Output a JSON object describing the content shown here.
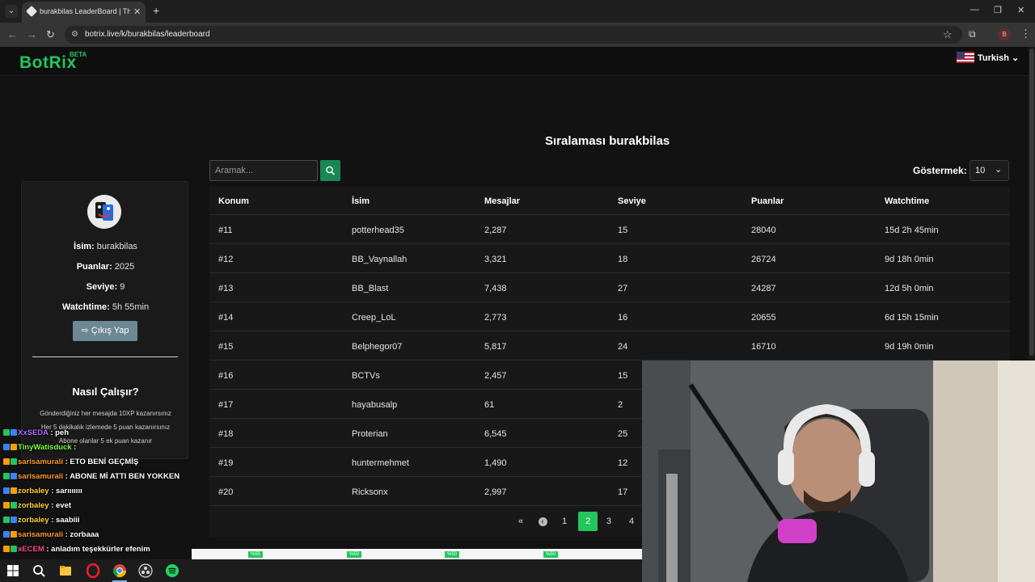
{
  "browser": {
    "tab_title": "burakbilas LeaderBoard | The b",
    "url": "botrix.live/k/burakbilas/leaderboard",
    "profile_initial": "B"
  },
  "header": {
    "logo": "BotRix",
    "beta": "BETA",
    "language": "Turkish"
  },
  "page": {
    "title": "Sıralaması burakbilas",
    "search_placeholder": "Aramak...",
    "show_label": "Göstermek:",
    "show_value": "10"
  },
  "profile": {
    "name_label": "İsim:",
    "name": "burakbilas",
    "points_label": "Puanlar:",
    "points": "2025",
    "level_label": "Seviye:",
    "level": "9",
    "watch_label": "Watchtime:",
    "watchtime": "5h 55min",
    "logout": "Çıkış Yap",
    "how_title": "Nasıl Çalışır?",
    "how_lines": [
      "Gönderdiğiniz her mesajda 10XP kazanırsınız",
      "Her 5 dakikalık izlemede 5 puan kazanırsınız",
      "Abone olanlar 5 ek puan kazanır"
    ]
  },
  "table": {
    "headers": [
      "Konum",
      "İsim",
      "Mesajlar",
      "Seviye",
      "Puanlar",
      "Watchtime"
    ],
    "rows": [
      [
        "#11",
        "potterhead35",
        "2,287",
        "15",
        "28040",
        "15d 2h 45min"
      ],
      [
        "#12",
        "BB_Vaynallah",
        "3,321",
        "18",
        "26724",
        "9d 18h 0min"
      ],
      [
        "#13",
        "BB_Blast",
        "7,438",
        "27",
        "24287",
        "12d 5h 0min"
      ],
      [
        "#14",
        "Creep_LoL",
        "2,773",
        "16",
        "20655",
        "6d 15h 15min"
      ],
      [
        "#15",
        "Belphegor07",
        "5,817",
        "24",
        "16710",
        "9d 19h 0min"
      ],
      [
        "#16",
        "BCTVs",
        "2,457",
        "15",
        "",
        ""
      ],
      [
        "#17",
        "hayabusalp",
        "61",
        "2",
        "",
        ""
      ],
      [
        "#18",
        "Proterian",
        "6,545",
        "25",
        "",
        ""
      ],
      [
        "#19",
        "huntermehmet",
        "1,490",
        "12",
        "",
        ""
      ],
      [
        "#20",
        "Ricksonx",
        "2,997",
        "17",
        "",
        ""
      ]
    ]
  },
  "pagination": {
    "first": "«",
    "prev": "‹",
    "pages": [
      "1",
      "2",
      "3",
      "4"
    ],
    "active": "2"
  },
  "strip": {
    "percents": [
      "%55",
      "%50",
      "%50",
      "%50"
    ]
  },
  "chat": [
    {
      "user": "XxSEDA",
      "msg": ": peh",
      "color": "#b06bff"
    },
    {
      "user": "TinyWatisduck",
      "msg": ":",
      "color": "#7fff3a"
    },
    {
      "user": "sarisamurali",
      "msg": ": ETO BENİ GEÇMİŞ",
      "color": "#ff9a2e"
    },
    {
      "user": "sarisamurali",
      "msg": ": ABONE Mİ ATTI BEN YOKKEN",
      "color": "#ff9a2e"
    },
    {
      "user": "zorbaley",
      "msg": ": sarııııııı",
      "color": "#ffd23a"
    },
    {
      "user": "zorbaley",
      "msg": ": evet",
      "color": "#ffd23a"
    },
    {
      "user": "zorbaley",
      "msg": ": saabiii",
      "color": "#ffd23a"
    },
    {
      "user": "sarisamurali",
      "msg": ": zorbaaa",
      "color": "#ff9a2e"
    },
    {
      "user": "xECEM",
      "msg": ": anladım teşekkürler efenim",
      "color": "#ff4b8b"
    }
  ],
  "colors": {
    "accent": "#22c55e",
    "search_button": "#198754",
    "logout_button": "#6c8796"
  },
  "icons": [
    "tab-menu-icon",
    "search-icon",
    "sign-out-icon",
    "chevron-down-icon",
    "double-chevron-left-icon",
    "chevron-left-icon"
  ]
}
